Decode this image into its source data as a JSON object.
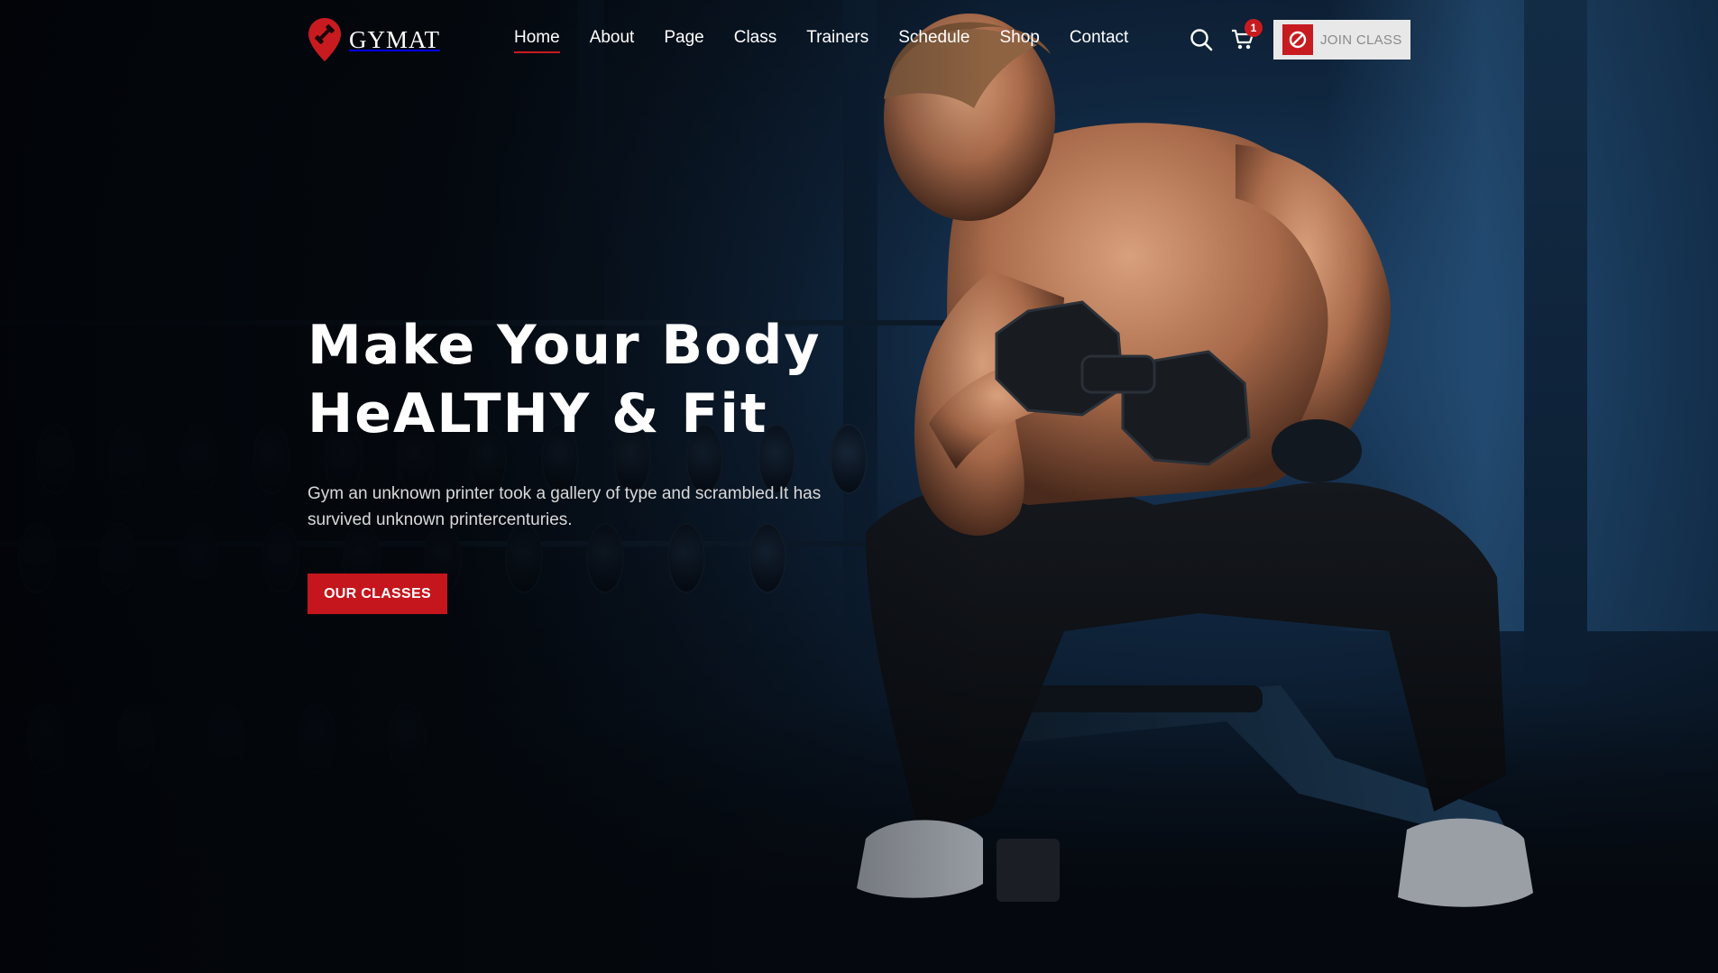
{
  "brand": {
    "name": "GYMAT",
    "logo_icon": "dumbbell-pin-icon"
  },
  "nav": {
    "items": [
      {
        "label": "Home",
        "active": true
      },
      {
        "label": "About",
        "active": false
      },
      {
        "label": "Page",
        "active": false
      },
      {
        "label": "Class",
        "active": false
      },
      {
        "label": "Trainers",
        "active": false
      },
      {
        "label": "Schedule",
        "active": false
      },
      {
        "label": "Shop",
        "active": false
      },
      {
        "label": "Contact",
        "active": false
      }
    ]
  },
  "header": {
    "search_icon": "search-icon",
    "cart_icon": "cart-icon",
    "cart_count": "1",
    "join_button": {
      "label": "JOIN CLASS",
      "icon": "join-class-icon"
    }
  },
  "hero": {
    "title_line1": "Make Your Body",
    "title_line2": "HeALTHY & Fit",
    "description": "Gym an unknown printer took a gallery of type and scrambled.It has survived unknown printercenturies.",
    "cta_label": "OUR CLASSES"
  },
  "colors": {
    "accent": "#c81b20",
    "background": "#05080d",
    "text": "#ffffff",
    "join_button_bg": "#e8e8e8"
  }
}
